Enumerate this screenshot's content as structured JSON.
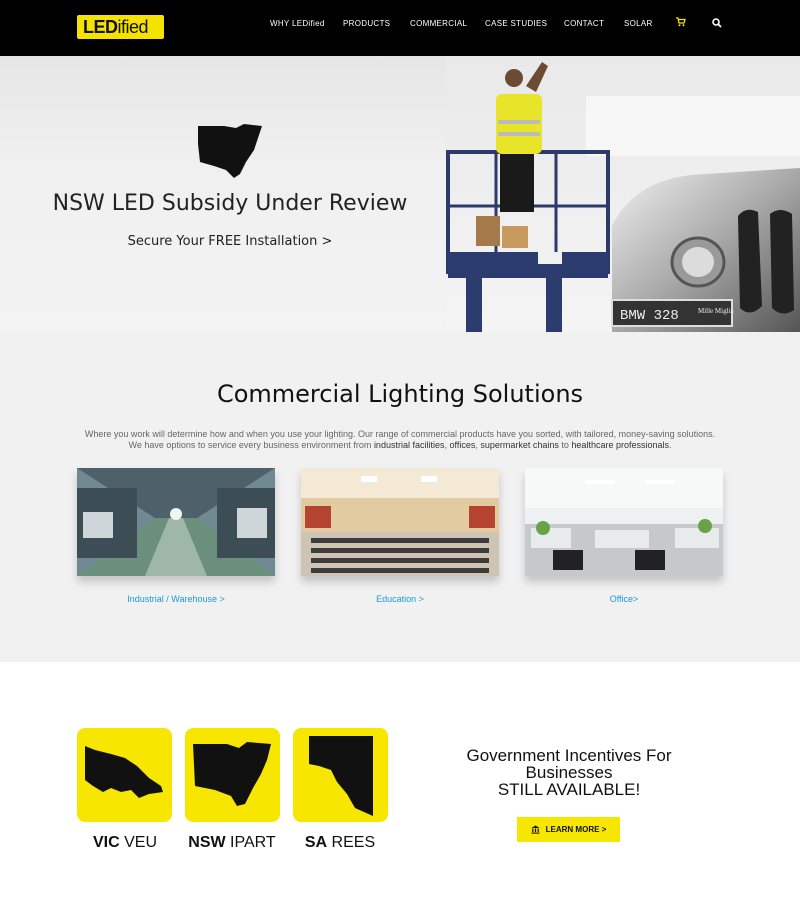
{
  "nav": {
    "logo_bold": "LED",
    "logo_rest": "ified",
    "items": [
      "WHY LEDified",
      "PRODUCTS",
      "COMMERCIAL",
      "CASE STUDIES",
      "CONTACT",
      "SOLAR"
    ],
    "cart_icon": "cart-icon",
    "search_icon": "search-icon"
  },
  "hero": {
    "title": "NSW LED Subsidy Under Review",
    "subtitle": "Secure Your FREE Installation >",
    "plate": "BMW 328",
    "plate_sub": "Mille Miglia"
  },
  "commercial": {
    "title": "Commercial Lighting Solutions",
    "desc_pre": "Where you work will determine how and when you use your lighting. Our range of commercial products have you sorted, with tailored, money-saving solutions. We have options to service every business environment from ",
    "desc_b1": "industrial facilities",
    "desc_s1": ", ",
    "desc_b2": "offices",
    "desc_s2": ", ",
    "desc_b3": "supermarket chains",
    "desc_s3": " to ",
    "desc_b4": "healthcare professionals",
    "desc_end": ".",
    "cards": [
      {
        "label": "Industrial / Warehouse >"
      },
      {
        "label": "Education >"
      },
      {
        "label": "Office>"
      }
    ]
  },
  "incentives": {
    "badges": [
      {
        "state": "VIC",
        "scheme": " VEU"
      },
      {
        "state": "NSW",
        "scheme": " IPART"
      },
      {
        "state": "SA",
        "scheme": " REES"
      }
    ],
    "heading_line1": "Government Incentives For",
    "heading_line2": "Businesses",
    "heading_line3": "STILL AVAILABLE!",
    "cta": "LEARN MORE >",
    "cta_icon": "bank-icon"
  },
  "colors": {
    "accent": "#f7e600",
    "link": "#1a9bd7",
    "nav_bg": "#000000"
  }
}
